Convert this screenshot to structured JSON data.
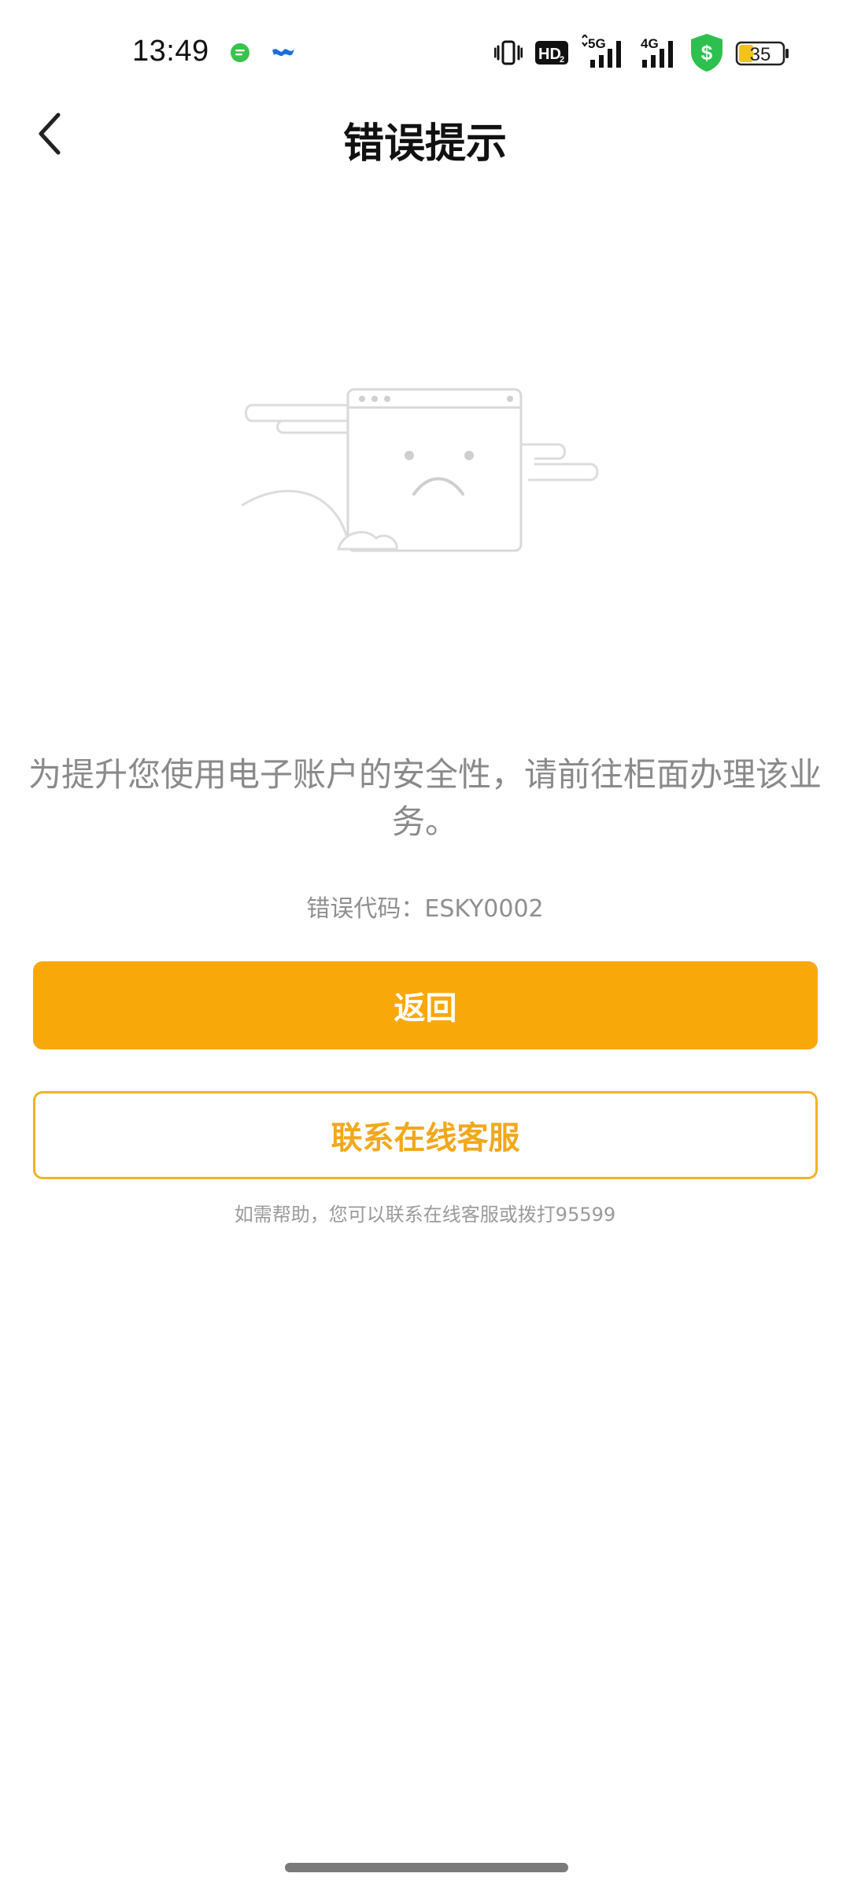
{
  "status_bar": {
    "time": "13:49",
    "icons": [
      "chat-bubble-icon",
      "bird-icon",
      "vibrate-icon",
      "hd-icon",
      "signal-5g-icon",
      "signal-4g-icon",
      "shield-dollar-icon",
      "battery-icon"
    ],
    "hd_label": "HD",
    "hd_sub": "2",
    "net1_label": "5G",
    "net2_label": "4G",
    "battery_level": "35"
  },
  "nav": {
    "title": "错误提示"
  },
  "main": {
    "message": "为提升您使用电子账户的安全性，请前往柜面办理该业务。",
    "error_code_label": "错误代码：",
    "error_code": "ESKY0002"
  },
  "actions": {
    "back_label": "返回",
    "contact_label": "联系在线客服"
  },
  "help": {
    "text": "如需帮助，您可以联系在线客服或拨打95599"
  },
  "colors": {
    "primary": "#f9a80a",
    "outline": "#f0b427",
    "outline_text": "#f2a81b",
    "message_text": "#8a8a8a",
    "shield_green": "#2ec04f",
    "chat_green": "#3ac24d",
    "bird_blue": "#1a6fd8"
  }
}
